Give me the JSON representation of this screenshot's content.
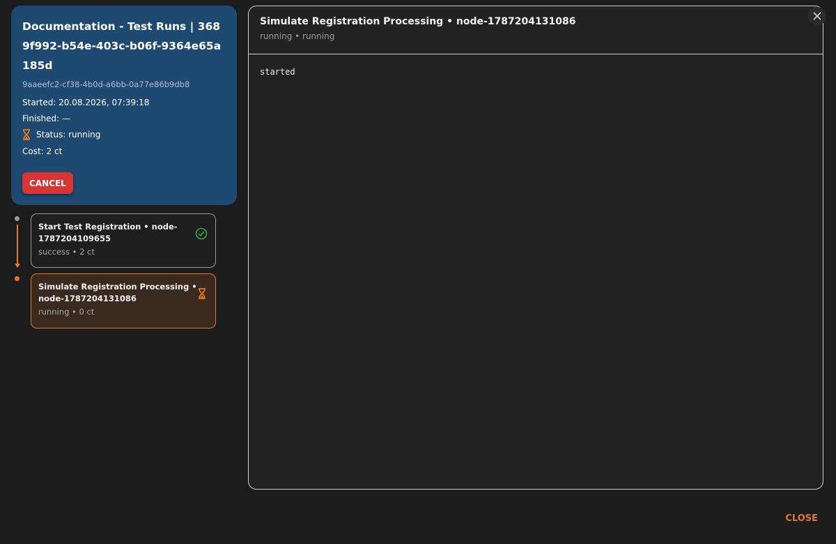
{
  "run": {
    "title": "Documentation - Test Runs | 3689f992-b54e-403c-b06f-9364e65a185d",
    "id": "9aaeefc2-cf38-4b0d-a6bb-0a77e86b9db8",
    "started": "Started: 20.08.2026, 07:39:18",
    "finished": "Finished: —",
    "status": "Status: running",
    "cost": "Cost: 2 ct",
    "cancel_label": "CANCEL"
  },
  "nodes": [
    {
      "title": "Start Test Registration • node-1787204109655",
      "sub": "success • 2 ct",
      "status_icon": "check-circle-icon"
    },
    {
      "title": "Simulate Registration Processing • node-1787204131086",
      "sub": "running • 0 ct",
      "status_icon": "hourglass-icon"
    }
  ],
  "detail": {
    "title": "Simulate Registration Processing • node-1787204131086",
    "sub": "running • running",
    "output": "started"
  },
  "footer": {
    "close_label": "CLOSE"
  },
  "colors": {
    "accent": "#e07a2a",
    "card_bg": "#1e4a72",
    "cancel": "#d93434",
    "success": "#3aa55a"
  }
}
